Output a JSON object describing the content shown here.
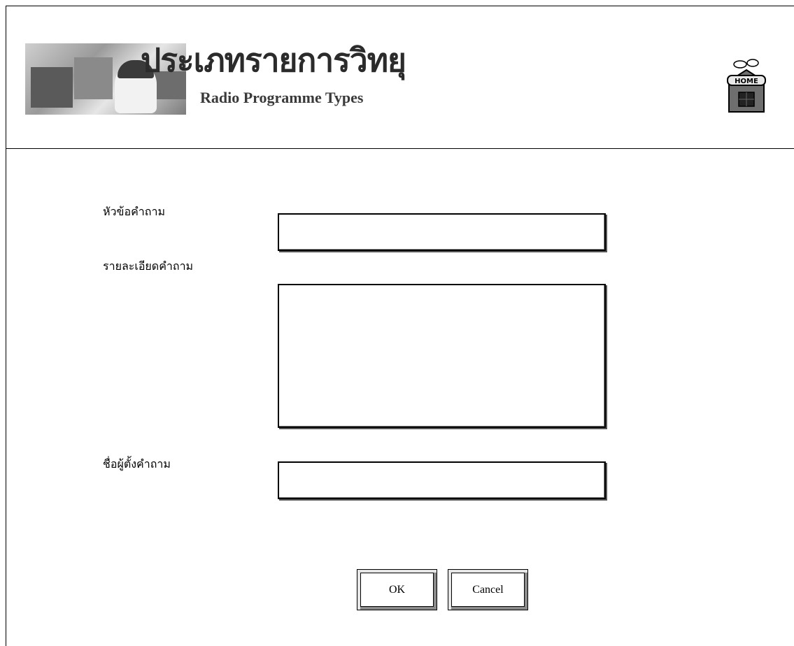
{
  "header": {
    "banner_title_thai": "ประเภทรายการวิทยุ",
    "banner_title_english": "Radio Programme Types",
    "home_label": "HOME"
  },
  "form": {
    "subject_label": "หัวข้อคำถาม",
    "subject_value": "",
    "detail_label": "รายละเอียดคำถาม",
    "detail_value": "",
    "author_label": "ชื่อผู้ตั้งคำถาม",
    "author_value": ""
  },
  "buttons": {
    "ok_label": "OK",
    "cancel_label": "Cancel"
  }
}
